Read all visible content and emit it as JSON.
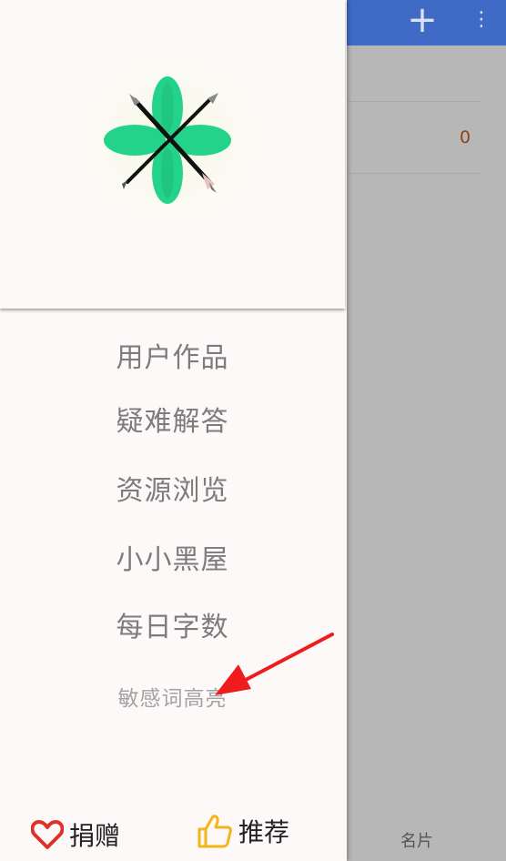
{
  "background": {
    "toolbar": {
      "add_icon": "plus-icon",
      "more_icon": "more-vert-icon",
      "add_glyph": "+",
      "more_glyph": "⋮"
    },
    "list": {
      "count": "0"
    },
    "bottom_tab": {
      "label": "名片"
    },
    "colors": {
      "toolbar": "#3f6bc6",
      "count": "#8b4513"
    }
  },
  "drawer": {
    "logo": "app-logo-flower-pens",
    "menu": [
      {
        "label": "用户作品"
      },
      {
        "label": "疑难解答"
      },
      {
        "label": "资源浏览"
      },
      {
        "label": "小小黑屋"
      },
      {
        "label": "每日字数"
      },
      {
        "label": "敏感词高亮"
      }
    ],
    "footer": {
      "donate": {
        "label": "捐赠",
        "icon": "heart-outline-icon",
        "color": "#e0302a"
      },
      "recommend": {
        "label": "推荐",
        "icon": "thumbs-up-icon",
        "color": "#f2b51a"
      }
    }
  },
  "annotation": {
    "type": "arrow",
    "color": "#ee1c1c",
    "target": "敏感词高亮"
  }
}
